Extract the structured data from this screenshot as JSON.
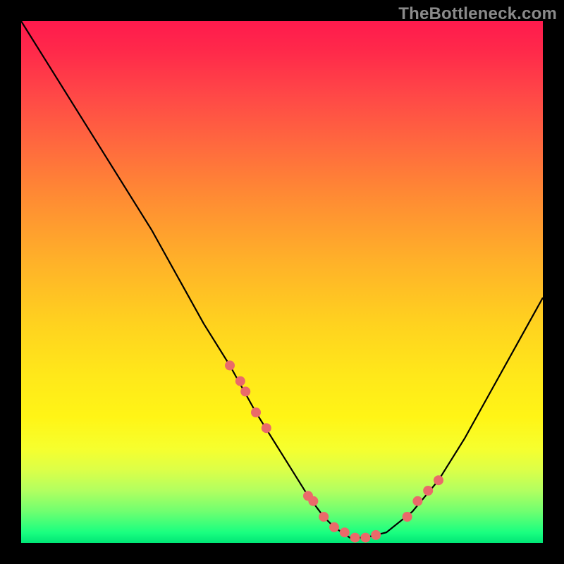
{
  "watermark": "TheBottleneck.com",
  "chart_data": {
    "type": "line",
    "title": "",
    "xlabel": "",
    "ylabel": "",
    "xlim": [
      0,
      100
    ],
    "ylim": [
      0,
      100
    ],
    "grid": false,
    "legend": false,
    "series": [
      {
        "name": "bottleneck-curve",
        "x": [
          0,
          5,
          10,
          15,
          20,
          25,
          30,
          35,
          40,
          45,
          50,
          55,
          58,
          60,
          63,
          66,
          70,
          75,
          80,
          85,
          90,
          95,
          100
        ],
        "y": [
          100,
          92,
          84,
          76,
          68,
          60,
          51,
          42,
          34,
          25,
          17,
          9,
          5,
          3,
          1,
          1,
          2,
          6,
          12,
          20,
          29,
          38,
          47
        ]
      }
    ],
    "markers": {
      "name": "highlighted-points",
      "color": "#ea6a6a",
      "radius": 7,
      "x": [
        40,
        42,
        43,
        45,
        47,
        55,
        56,
        58,
        60,
        62,
        64,
        66,
        68,
        74,
        76,
        78,
        80
      ],
      "y": [
        34,
        31,
        29,
        25,
        22,
        9,
        8,
        5,
        3,
        2,
        1,
        1,
        1.5,
        5,
        8,
        10,
        12
      ]
    },
    "background_gradient": {
      "top": "#ff1a4d",
      "mid": "#ffe81a",
      "bottom": "#00e676"
    }
  }
}
